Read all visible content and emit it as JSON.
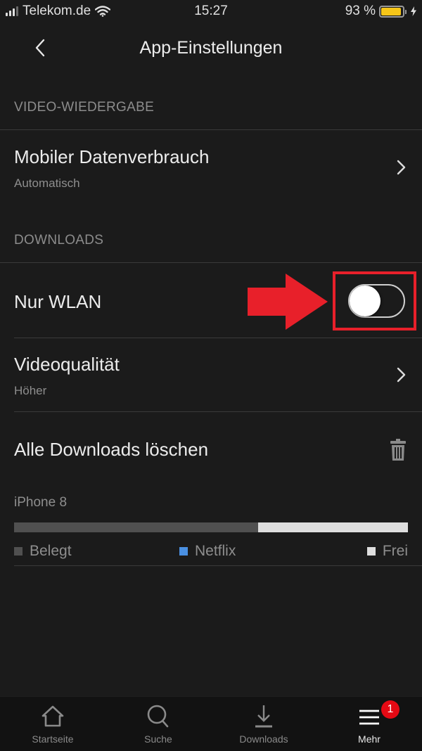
{
  "status_bar": {
    "carrier": "Telekom.de",
    "time": "15:27",
    "battery_percent_label": "93 %",
    "battery_level": 0.93,
    "battery_color": "#f5c518",
    "signal_bars_active": 3,
    "signal_bars_total": 4
  },
  "nav": {
    "back_icon": "chevron-left-icon",
    "title": "App-Einstellungen"
  },
  "sections": {
    "video_playback": {
      "header": "VIDEO-WIEDERGABE",
      "mobile_data": {
        "title": "Mobiler Datenverbrauch",
        "value": "Automatisch"
      }
    },
    "downloads": {
      "header": "DOWNLOADS",
      "wifi_only": {
        "title": "Nur WLAN",
        "enabled": false
      },
      "video_quality": {
        "title": "Videoqualität",
        "value": "Höher"
      },
      "delete_all": {
        "title": "Alle Downloads löschen",
        "icon": "trash-icon"
      }
    }
  },
  "storage": {
    "device": "iPhone 8",
    "used_fraction": 0.62,
    "netflix_fraction": 0.0,
    "free_fraction": 0.38,
    "legend": [
      {
        "label": "Belegt",
        "color": "#505050"
      },
      {
        "label": "Netflix",
        "color": "#4a90e2"
      },
      {
        "label": "Frei",
        "color": "#dedede"
      }
    ]
  },
  "annotation": {
    "color": "#e8202a",
    "arrow_icon": "arrow-right-icon"
  },
  "tab_bar": {
    "tabs": [
      {
        "label": "Startseite",
        "icon": "home-icon",
        "active": false
      },
      {
        "label": "Suche",
        "icon": "search-icon",
        "active": false
      },
      {
        "label": "Downloads",
        "icon": "download-icon",
        "active": false
      },
      {
        "label": "Mehr",
        "icon": "menu-icon",
        "active": true
      }
    ],
    "badge_count": "1",
    "badge_color": "#e50914"
  }
}
